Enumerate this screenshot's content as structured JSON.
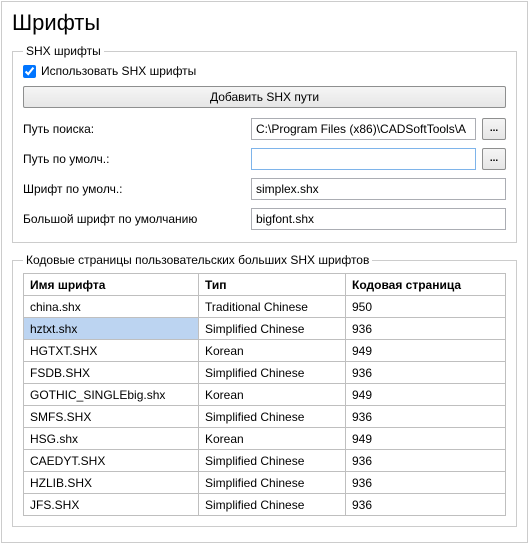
{
  "title": "Шрифты",
  "shx_group": {
    "legend": "SHX шрифты",
    "use_shx_label": "Использовать SHX шрифты",
    "use_shx_checked": true,
    "add_path_btn": "Добавить SHX пути",
    "search_path_label": "Путь поиска:",
    "search_path_value": "C:\\Program Files (x86)\\CADSoftTools\\A",
    "default_path_label": "Путь по умолч.:",
    "default_path_value": "",
    "default_font_label": "Шрифт по умолч.:",
    "default_font_value": "simplex.shx",
    "default_big_font_label": "Большой шрифт по умолчанию",
    "default_big_font_value": "bigfont.shx",
    "browse_glyph": "..."
  },
  "cp_group": {
    "legend": "Кодовые страницы пользовательских больших SHX шрифтов",
    "columns": {
      "name": "Имя шрифта",
      "type": "Тип",
      "cp": "Кодовая страница"
    },
    "rows": [
      {
        "name": "china.shx",
        "type": "Traditional Chinese",
        "cp": "950",
        "selected": false
      },
      {
        "name": "hztxt.shx",
        "type": "Simplified Chinese",
        "cp": "936",
        "selected": true
      },
      {
        "name": "HGTXT.SHX",
        "type": "Korean",
        "cp": "949",
        "selected": false
      },
      {
        "name": "FSDB.SHX",
        "type": "Simplified Chinese",
        "cp": "936",
        "selected": false
      },
      {
        "name": "GOTHIC_SINGLEbig.shx",
        "type": "Korean",
        "cp": "949",
        "selected": false
      },
      {
        "name": "SMFS.SHX",
        "type": "Simplified Chinese",
        "cp": "936",
        "selected": false
      },
      {
        "name": "HSG.shx",
        "type": "Korean",
        "cp": "949",
        "selected": false
      },
      {
        "name": "CAEDYT.SHX",
        "type": "Simplified Chinese",
        "cp": "936",
        "selected": false
      },
      {
        "name": "HZLIB.SHX",
        "type": "Simplified Chinese",
        "cp": "936",
        "selected": false
      },
      {
        "name": "JFS.SHX",
        "type": "Simplified Chinese",
        "cp": "936",
        "selected": false
      }
    ]
  }
}
